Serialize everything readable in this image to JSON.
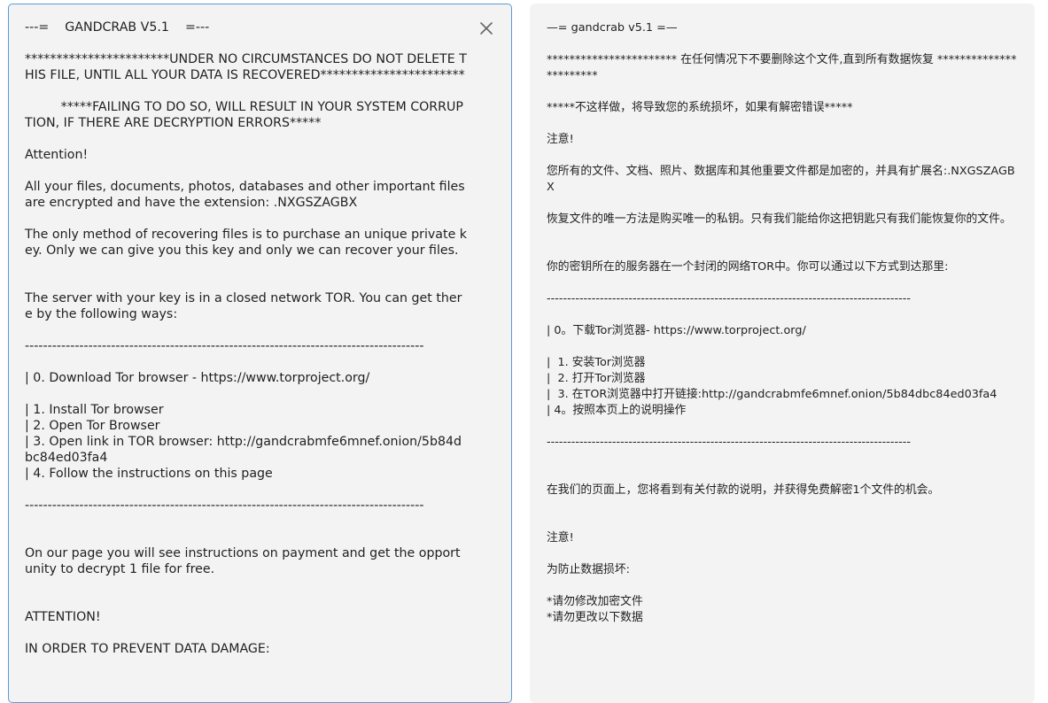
{
  "left_pane": {
    "close_icon": "close-icon",
    "lines": [
      "---=    GANDCRAB V5.1    =---",
      "",
      "***********************UNDER NO CIRCUMSTANCES DO NOT DELETE THIS FILE, UNTIL ALL YOUR DATA IS RECOVERED***********************",
      "",
      "         *****FAILING TO DO SO, WILL RESULT IN YOUR SYSTEM CORRUPTION, IF THERE ARE DECRYPTION ERRORS*****",
      "",
      "Attention!",
      "",
      "All your files, documents, photos, databases and other important files are encrypted and have the extension: .NXGSZAGBX",
      "",
      "The only method of recovering files is to purchase an unique private key. Only we can give you this key and only we can recover your files.",
      "",
      "",
      "The server with your key is in a closed network TOR. You can get there by the following ways:",
      "",
      "----------------------------------------------------------------------------------------",
      "",
      "| 0. Download Tor browser - https://www.torproject.org/",
      "",
      "| 1. Install Tor browser",
      "| 2. Open Tor Browser",
      "| 3. Open link in TOR browser: http://gandcrabmfe6mnef.onion/5b84dbc84ed03fa4",
      "| 4. Follow the instructions on this page",
      "",
      "----------------------------------------------------------------------------------------",
      "",
      "",
      "On our page you will see instructions on payment and get the opportunity to decrypt 1 file for free.",
      "",
      "",
      "ATTENTION!",
      "",
      "IN ORDER TO PREVENT DATA DAMAGE:"
    ]
  },
  "right_pane": {
    "lines": [
      "—= gandcrab v5.1 =—",
      "",
      "*********************** 在任何情况下不要删除这个文件,直到所有数据恢复 ***********************",
      "",
      "*****不这样做，将导致您的系统损坏，如果有解密错误*****",
      "",
      "注意!",
      "",
      "您所有的文件、文档、照片、数据库和其他重要文件都是加密的，并具有扩展名:.NXGSZAGBX",
      "",
      "恢复文件的唯一方法是购买唯一的私钥。只有我们能给你这把钥匙只有我们能恢复你的文件。",
      "",
      "",
      "你的密钥所在的服务器在一个封闭的网络TOR中。你可以通过以下方式到达那里:",
      "",
      "-----------------------------------------------------------------------------------------",
      "",
      "| 0。下载Tor浏览器- https://www.torproject.org/",
      "",
      "|  1. 安装Tor浏览器",
      "|  2. 打开Tor浏览器",
      "|  3. 在TOR浏览器中打开链接:http://gandcrabmfe6mnef.onion/5b84dbc84ed03fa4",
      "| 4。按照本页上的说明操作",
      "",
      "-----------------------------------------------------------------------------------------",
      "",
      "",
      "在我们的页面上，您将看到有关付款的说明，并获得免费解密1个文件的机会。",
      "",
      "",
      "注意!",
      "",
      "为防止数据损坏:",
      "",
      "*请勿修改加密文件",
      "*请勿更改以下数据"
    ]
  }
}
